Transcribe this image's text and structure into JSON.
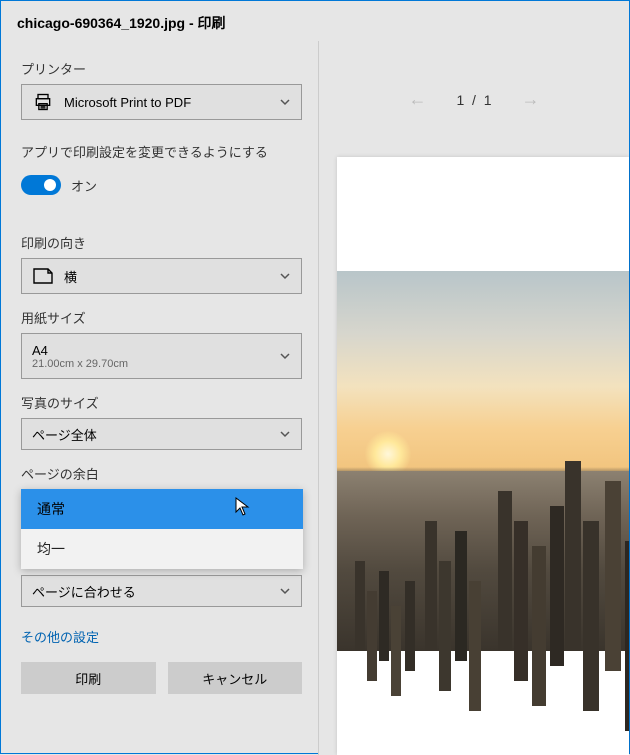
{
  "window_title": "chicago-690364_1920.jpg - 印刷",
  "printer_section_label": "プリンター",
  "printer_selected": "Microsoft Print to PDF",
  "app_settings_label": "アプリで印刷設定を変更できるようにする",
  "toggle_state_label": "オン",
  "orientation_label": "印刷の向き",
  "orientation_value": "横",
  "paper_size_label": "用紙サイズ",
  "paper_size_value": "A4",
  "paper_size_dims": "21.00cm x 29.70cm",
  "photo_size_label": "写真のサイズ",
  "photo_size_value": "ページ全体",
  "margin_label": "ページの余白",
  "margin_options": {
    "opt0": "通常",
    "opt1": "均一"
  },
  "fit_label": "ページに合わせる",
  "more_settings": "その他の設定",
  "print_btn": "印刷",
  "cancel_btn": "キャンセル",
  "pager": {
    "current": "1",
    "sep": "/",
    "total": "1"
  }
}
